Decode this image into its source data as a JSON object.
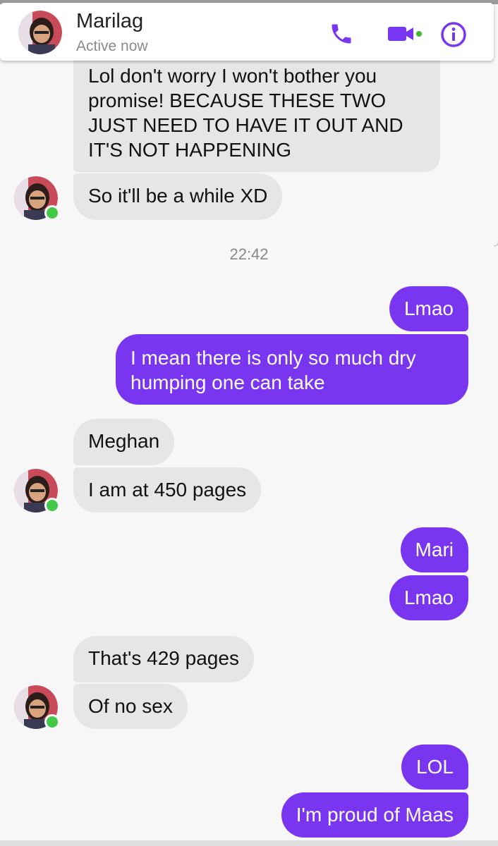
{
  "contact": {
    "name": "Marilag",
    "status": "Active now"
  },
  "header_icons": [
    "phone-icon",
    "video-camera-icon",
    "info-icon"
  ],
  "colors": {
    "accent": "#7a35f0",
    "incoming_bubble": "#e6e6e6",
    "online": "#44c84a"
  },
  "timestamp": "22:42",
  "messages": {
    "m1": "Lol don't worry I won't bother you promise! BECAUSE THESE TWO JUST NEED TO HAVE IT OUT AND IT'S NOT HAPPENING",
    "m2": "So it'll be a while XD",
    "m3": "Lmao",
    "m4": "I mean there is only so much dry humping one can take",
    "m5": "Meghan",
    "m6": "I am at 450 pages",
    "m7": "Mari",
    "m8": "Lmao",
    "m9": "That's 429 pages",
    "m10": "Of no sex",
    "m11": "LOL",
    "m12": "I'm proud of Maas"
  }
}
